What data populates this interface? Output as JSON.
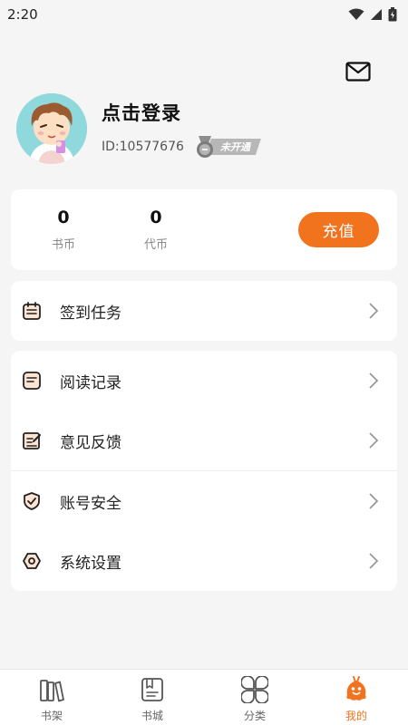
{
  "status_bar": {
    "time": "2:20"
  },
  "profile": {
    "login_prompt": "点击登录",
    "user_id": "ID:10577676",
    "vip_status": "未开通"
  },
  "wallet": {
    "coins_value": "0",
    "coins_label": "书币",
    "vouchers_value": "0",
    "vouchers_label": "代币",
    "recharge_label": "充值"
  },
  "menu": {
    "checkin": "签到任务",
    "reading_history": "阅读记录",
    "feedback": "意见反馈",
    "account_security": "账号安全",
    "settings": "系统设置"
  },
  "tabs": [
    {
      "label": "书架",
      "icon": "bookshelf-icon"
    },
    {
      "label": "书城",
      "icon": "bookstore-icon"
    },
    {
      "label": "分类",
      "icon": "category-icon"
    },
    {
      "label": "我的",
      "icon": "mine-icon"
    }
  ],
  "colors": {
    "accent": "#f2731e",
    "background": "#f5f5f5",
    "card": "#ffffff"
  }
}
